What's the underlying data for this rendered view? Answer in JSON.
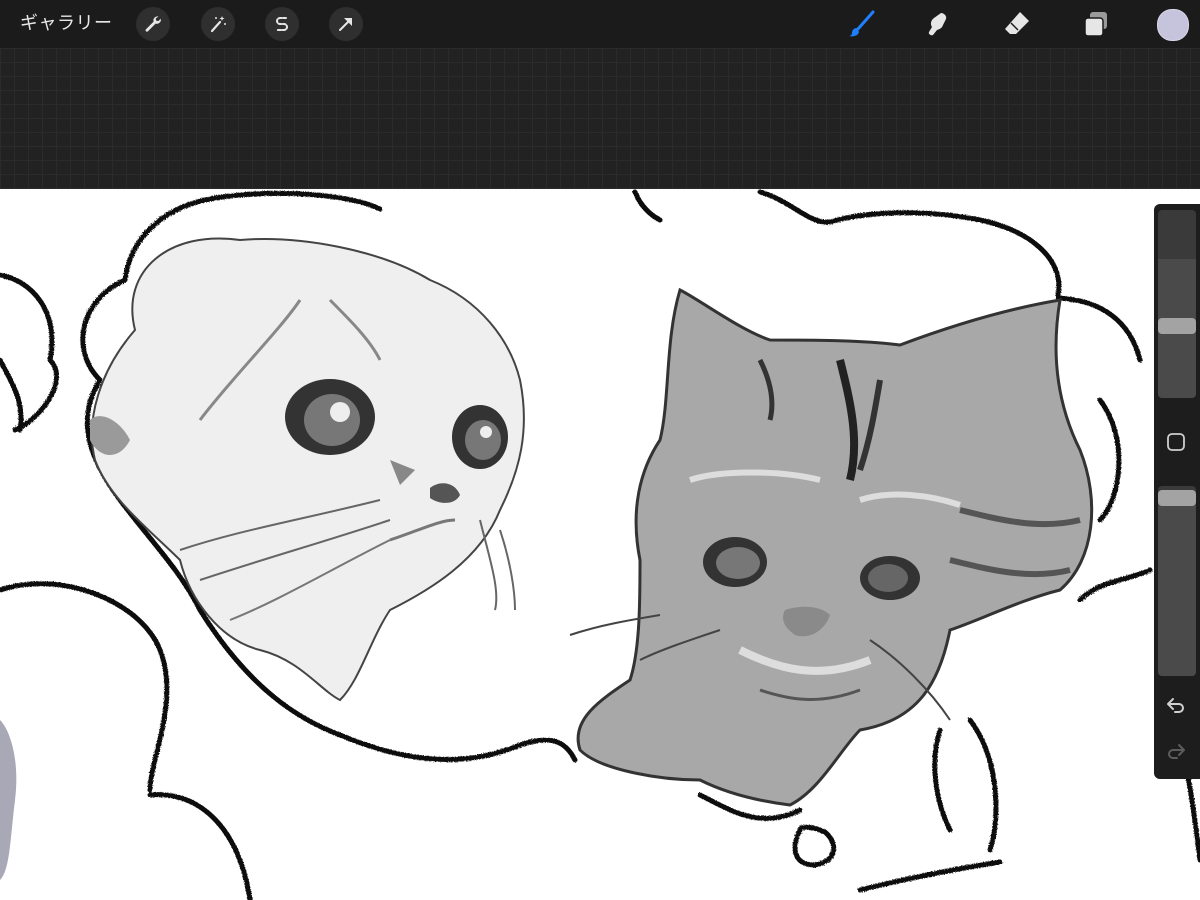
{
  "toolbar": {
    "gallery_label": "ギャラリー",
    "left_tools": [
      "wrench-icon",
      "magic-wand-icon",
      "selection-s-icon",
      "transform-arrow-icon"
    ],
    "right_tools": [
      "brush-icon",
      "smudge-icon",
      "eraser-icon",
      "layers-icon"
    ],
    "active_tool": "brush-icon",
    "accent_color": "#1e7fff",
    "current_color": "#c6c3dc"
  },
  "sidebar": {
    "brush_size_level": 0.74,
    "opacity_level": 0.92,
    "undo_icon": "undo-arrow-icon",
    "redo_icon": "redo-arrow-icon"
  },
  "canvas": {
    "background": "#ffffff",
    "content": "sketch-of-two-cats-in-thought-bubbles"
  }
}
